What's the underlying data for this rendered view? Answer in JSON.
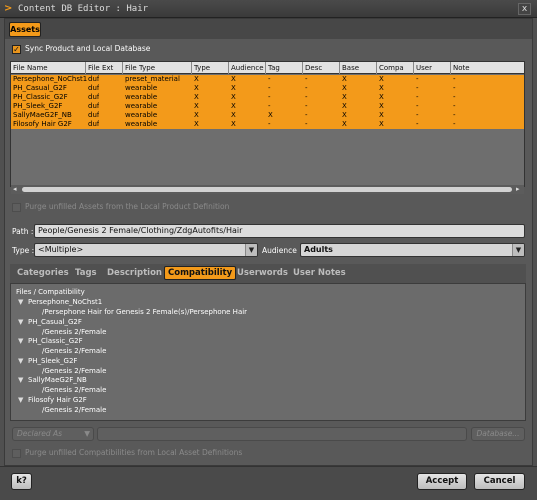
{
  "window": {
    "title": "Content DB Editor : Hair",
    "close_glyph": "x",
    "app_icon": "daz-icon"
  },
  "assets_tab": {
    "label": "Assets"
  },
  "sync": {
    "label": "Sync Product and Local Database",
    "checked": true
  },
  "table": {
    "columns": [
      "File Name",
      "File Ext",
      "File Type",
      "Type",
      "Audience",
      "Tag",
      "Desc",
      "Base",
      "Compat",
      "User",
      "Note"
    ],
    "rows": [
      [
        "Persephone_NoChst1",
        "duf",
        "preset_material",
        "X",
        "X",
        "-",
        "-",
        "X",
        "X",
        "-",
        "-"
      ],
      [
        "PH_Casual_G2F",
        "duf",
        "wearable",
        "X",
        "X",
        "-",
        "-",
        "X",
        "X",
        "-",
        "-"
      ],
      [
        "PH_Classic_G2F",
        "duf",
        "wearable",
        "X",
        "X",
        "-",
        "-",
        "X",
        "X",
        "-",
        "-"
      ],
      [
        "PH_Sleek_G2F",
        "duf",
        "wearable",
        "X",
        "X",
        "-",
        "-",
        "X",
        "X",
        "-",
        "-"
      ],
      [
        "SallyMaeG2F_NB",
        "duf",
        "wearable",
        "X",
        "X",
        "X",
        "-",
        "X",
        "X",
        "-",
        "-"
      ],
      [
        "Filosofy Hair G2F",
        "duf",
        "wearable",
        "X",
        "X",
        "-",
        "-",
        "X",
        "X",
        "-",
        "-"
      ]
    ],
    "compat_header_display": "Compa"
  },
  "purge_assets": {
    "label": "Purge unfilled Assets from the Local Product Definition"
  },
  "path": {
    "label": "Path :",
    "value": "People/Genesis 2 Female/Clothing/ZdgAutofits/Hair"
  },
  "type": {
    "label": "Type :",
    "value": "<Multiple>"
  },
  "audience": {
    "label": "Audience :",
    "value": "Adults"
  },
  "tabs": [
    "Categories",
    "Tags",
    "Description",
    "Compatibility",
    "Userwords",
    "User Notes"
  ],
  "active_tab": "Compatibility",
  "compat": {
    "header": "Files / Compatibility",
    "items": [
      {
        "file": "Persephone_NoChst1",
        "compat": "/Persephone Hair for Genesis 2 Female(s)/Persephone Hair"
      },
      {
        "file": "PH_Casual_G2F",
        "compat": "/Genesis 2/Female"
      },
      {
        "file": "PH_Classic_G2F",
        "compat": "/Genesis 2/Female"
      },
      {
        "file": "PH_Sleek_G2F",
        "compat": "/Genesis 2/Female"
      },
      {
        "file": "SallyMaeG2F_NB",
        "compat": "/Genesis 2/Female"
      },
      {
        "file": "Filosofy Hair G2F",
        "compat": "/Genesis 2/Female"
      }
    ]
  },
  "declared_as": {
    "label": "Declared As"
  },
  "database_btn": {
    "label": "Database..."
  },
  "purge_compat": {
    "label": "Purge unfilled Compatibilities from Local Asset Definitions"
  },
  "help_btn": {
    "label": "k?"
  },
  "accept_btn": {
    "label": "Accept"
  },
  "cancel_btn": {
    "label": "Cancel"
  },
  "colors": {
    "accent": "#f39a1a",
    "background": "#505050"
  }
}
